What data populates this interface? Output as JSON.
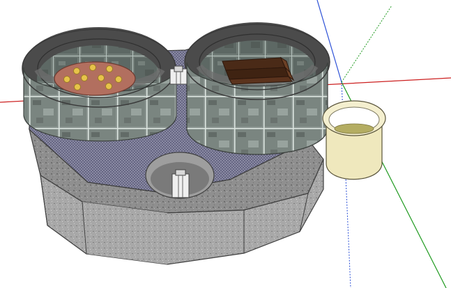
{
  "viewport": {
    "background": "#ffffff",
    "axis_colors": {
      "red": "#cc1f1f",
      "green": "#1f9a1f",
      "blue": "#2a4fd6"
    }
  },
  "model": {
    "objects": [
      {
        "kind": "octagonal-stone-base",
        "material": "granite-gray"
      },
      {
        "kind": "perforated-top-plate",
        "material": "blue-dot-pattern"
      },
      {
        "kind": "glass-block-ring-left"
      },
      {
        "kind": "glass-block-ring-right"
      },
      {
        "kind": "round-burner-plate",
        "dots": 9
      },
      {
        "kind": "wood-logs",
        "count": 3
      },
      {
        "kind": "center-air-hole"
      },
      {
        "kind": "small-white-posts",
        "count": 2
      },
      {
        "kind": "cream-cup",
        "contents": "olive-liquid"
      }
    ]
  },
  "colors": {
    "stone": "#8f8f8f",
    "top_plate": "#7b7b9a",
    "glass": "#8b9590",
    "glass_edge": "#5f6863",
    "burner": "#b26f5f",
    "burner_dots": "#e7c34a",
    "logs": "#4a2a17",
    "cup_outer": "#efe8bd",
    "cup_liquid": "#b4ad62"
  }
}
